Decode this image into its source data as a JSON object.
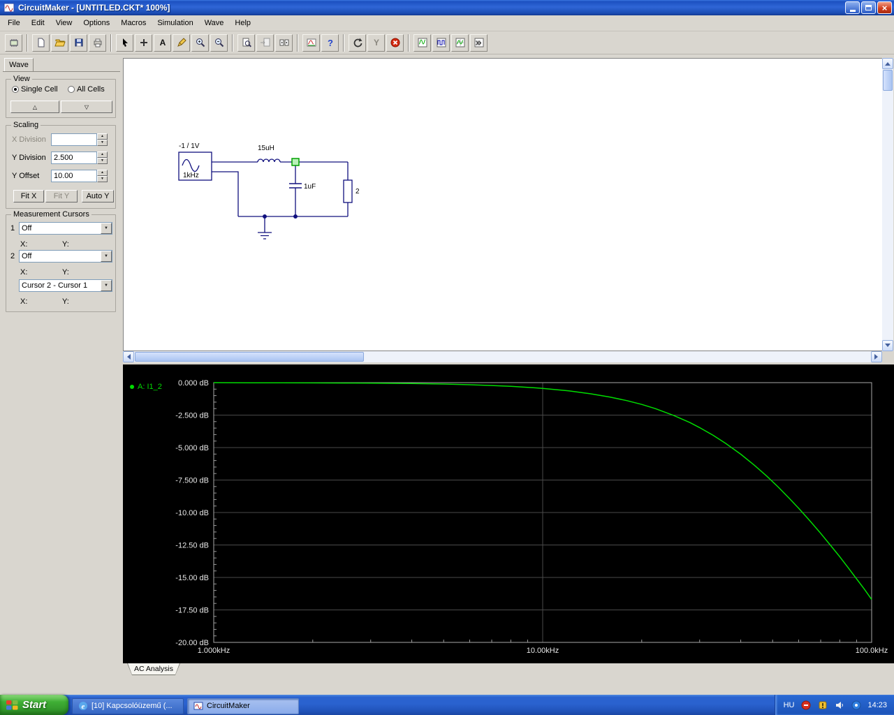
{
  "window": {
    "title": "CircuitMaker - [UNTITLED.CKT* 100%]"
  },
  "menu": [
    "File",
    "Edit",
    "View",
    "Options",
    "Macros",
    "Simulation",
    "Wave",
    "Help"
  ],
  "toolbar_icons": [
    "parts-browser",
    "new-file",
    "open-file",
    "save",
    "print",
    "arrow-tool",
    "add-part",
    "text-tool",
    "delete-tool",
    "zoom-in-tool",
    "zoom-out-tool",
    "find-device",
    "page-copy",
    "split-view",
    "run-analyses",
    "help",
    "reset-simulation",
    "probe-tool",
    "stop-simulation",
    "analog-waveform-window",
    "digital-waveform-window",
    "oscilloscope-window",
    "logic-analyzer-window"
  ],
  "wave_panel": {
    "tab_label": "Wave",
    "view_group": {
      "title": "View",
      "single_cell": "Single Cell",
      "all_cells": "All Cells",
      "selected": "Single Cell"
    },
    "scaling_group": {
      "title": "Scaling",
      "rows": [
        {
          "label": "X Division",
          "value": ""
        },
        {
          "label": "Y Division",
          "value": "2.500"
        },
        {
          "label": "Y Offset",
          "value": "10.00"
        }
      ],
      "buttons": [
        "Fit X",
        "Fit Y",
        "Auto Y"
      ]
    },
    "cursor_group": {
      "title": "Measurement Cursors",
      "cursor1_num": "1",
      "cursor1_value": "Off",
      "cursor2_num": "2",
      "cursor2_value": "Off",
      "difference_value": "Cursor 2 - Cursor 1",
      "x_label": "X:",
      "y_label": "Y:"
    }
  },
  "circuit": {
    "source_label": "-1 / 1V",
    "source_freq": "1kHz",
    "inductor_label": "15uH",
    "capacitor_label": "1uF",
    "resistor_label": "2"
  },
  "chart_data": {
    "type": "line",
    "title": "AC Analysis",
    "background": "#000000",
    "grid": true,
    "legend_position": "top-left",
    "x_axis": {
      "scale": "log",
      "range_khz": [
        1,
        100
      ],
      "tick_values_khz": [
        1,
        10,
        100
      ],
      "tick_labels": [
        "1.000kHz",
        "10.00kHz",
        "100.0kHz"
      ]
    },
    "y_axis": {
      "range_db": [
        0,
        -20
      ],
      "tick_values_db": [
        0,
        -2.5,
        -5,
        -7.5,
        -10,
        -12.5,
        -15,
        -17.5,
        -20
      ],
      "tick_labels": [
        "0.000 dB",
        "-2.500 dB",
        "-5.000 dB",
        "-7.500 dB",
        "-10.00 dB",
        "-12.50 dB",
        "-15.00 dB",
        "-17.50 dB",
        "-20.00 dB"
      ]
    },
    "series": [
      {
        "name": "A: I1_2",
        "color": "#00dc00",
        "points_khz_db": [
          [
            1,
            0.0
          ],
          [
            1.3,
            -0.01
          ],
          [
            1.6,
            -0.01
          ],
          [
            2,
            -0.02
          ],
          [
            2.5,
            -0.03
          ],
          [
            3,
            -0.04
          ],
          [
            4,
            -0.07
          ],
          [
            5,
            -0.11
          ],
          [
            6,
            -0.16
          ],
          [
            7,
            -0.22
          ],
          [
            8,
            -0.28
          ],
          [
            9,
            -0.36
          ],
          [
            10,
            -0.44
          ],
          [
            12,
            -0.63
          ],
          [
            14,
            -0.86
          ],
          [
            16,
            -1.11
          ],
          [
            18,
            -1.38
          ],
          [
            20,
            -1.68
          ],
          [
            22,
            -2.0
          ],
          [
            25,
            -2.52
          ],
          [
            28,
            -3.07
          ],
          [
            30,
            -3.46
          ],
          [
            33,
            -4.06
          ],
          [
            36,
            -4.68
          ],
          [
            40,
            -5.51
          ],
          [
            44,
            -6.36
          ],
          [
            48,
            -7.2
          ],
          [
            52,
            -8.04
          ],
          [
            56,
            -8.87
          ],
          [
            60,
            -9.67
          ],
          [
            65,
            -10.66
          ],
          [
            70,
            -11.6
          ],
          [
            75,
            -12.53
          ],
          [
            80,
            -13.41
          ],
          [
            85,
            -14.28
          ],
          [
            90,
            -15.11
          ],
          [
            95,
            -15.9
          ],
          [
            100,
            -16.7
          ]
        ]
      }
    ]
  },
  "bottom_tab": "AC Analysis",
  "taskbar": {
    "start_label": "Start",
    "task1": "[10] Kapcsolóüzemű (...",
    "task2": "CircuitMaker",
    "tray_language": "HU",
    "tray_time": "14:23"
  }
}
